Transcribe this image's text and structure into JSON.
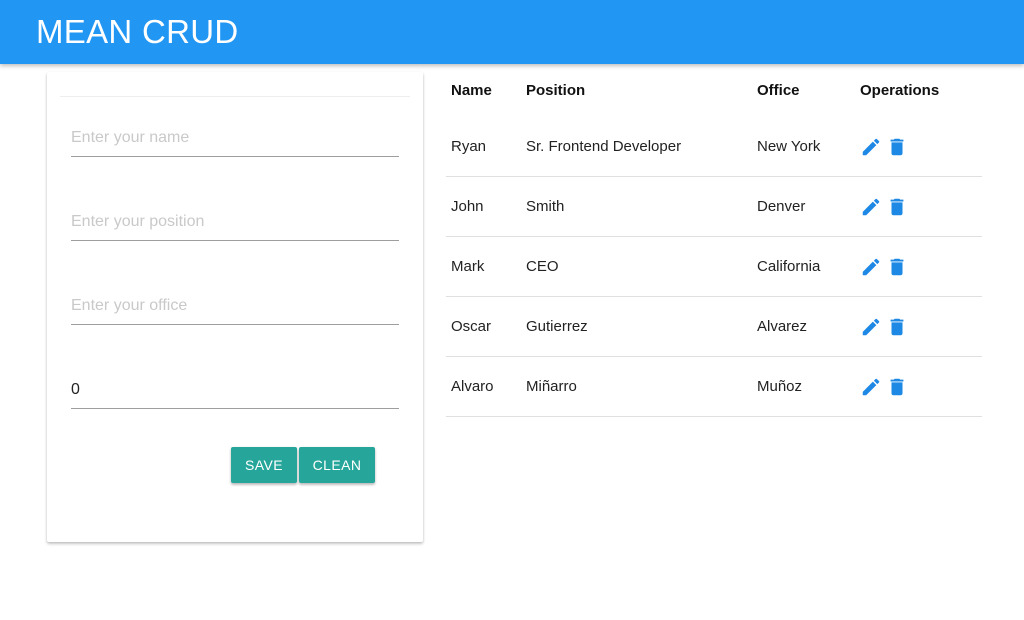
{
  "app": {
    "title": "MEAN CRUD"
  },
  "form": {
    "name": {
      "placeholder": "Enter your name",
      "value": ""
    },
    "position": {
      "placeholder": "Enter your position",
      "value": ""
    },
    "office": {
      "placeholder": "Enter your office",
      "value": ""
    },
    "salary": {
      "placeholder": "",
      "value": "0"
    },
    "save_label": "SAVE",
    "clean_label": "CLEAN"
  },
  "table": {
    "headers": [
      "Name",
      "Position",
      "Office",
      "Operations"
    ],
    "rows": [
      {
        "name": "Ryan",
        "position": "Sr. Frontend Developer",
        "office": "New York"
      },
      {
        "name": "John",
        "position": "Smith",
        "office": "Denver"
      },
      {
        "name": "Mark",
        "position": "CEO",
        "office": "California"
      },
      {
        "name": "Oscar",
        "position": "Gutierrez",
        "office": "Alvarez"
      },
      {
        "name": "Alvaro",
        "position": "Miñarro",
        "office": "Muñoz"
      }
    ],
    "row_icons": [
      "edit-icon",
      "delete-icon"
    ]
  },
  "colors": {
    "navbar": "#2196f3",
    "button": "#26a69a",
    "icon": "#1e88e5"
  }
}
